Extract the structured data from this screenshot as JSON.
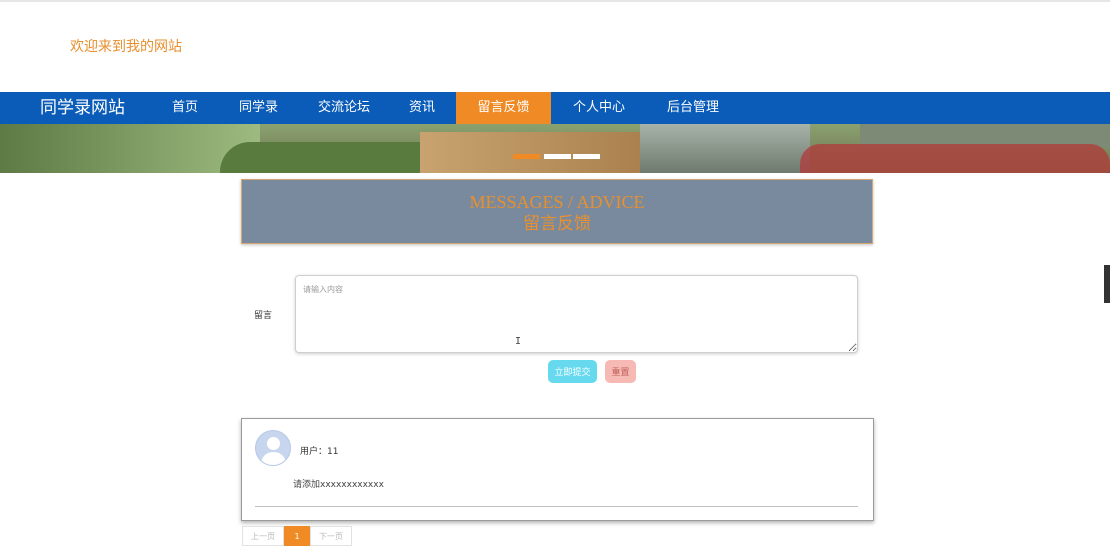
{
  "header": {
    "welcome": "欢迎来到我的网站"
  },
  "nav": {
    "brand": "同学录网站",
    "items": [
      {
        "label": "首页"
      },
      {
        "label": "同学录"
      },
      {
        "label": "交流论坛"
      },
      {
        "label": "资讯"
      },
      {
        "label": "留言反馈"
      },
      {
        "label": "个人中心"
      },
      {
        "label": "后台管理"
      }
    ],
    "active_index": 4,
    "active_color": "#f08a24",
    "bar_color": "#0b5cb8"
  },
  "banner": {
    "slides": 3,
    "active_slide": 0
  },
  "section": {
    "title_en": "MESSAGES / ADVICE",
    "title_zh": "留言反馈"
  },
  "form": {
    "label": "留言",
    "textarea_placeholder": "请输入内容",
    "textarea_value": "",
    "submit_label": "立即提交",
    "reset_label": "重置"
  },
  "messages": [
    {
      "user_label": "用户：11",
      "content": "请添加xxxxxxxxxxxx"
    }
  ],
  "pagination": {
    "prev": "上一页",
    "current": "1",
    "next": "下一页"
  }
}
